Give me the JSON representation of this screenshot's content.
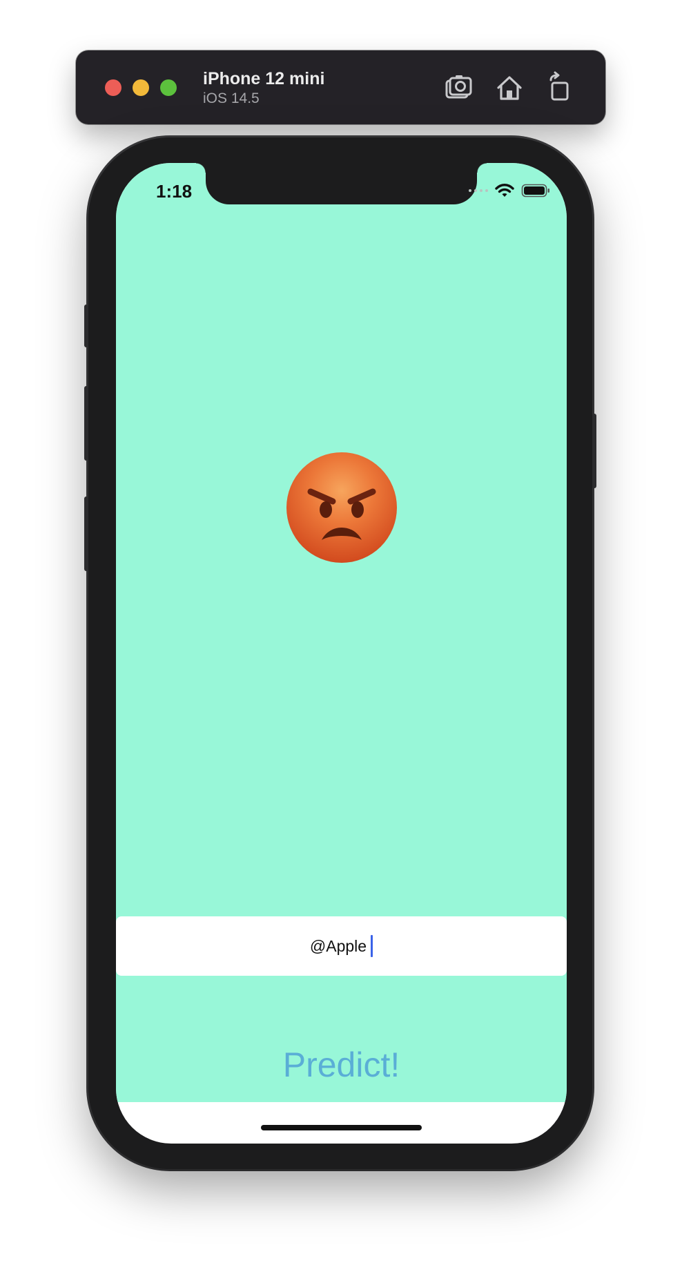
{
  "simulator": {
    "device_name": "iPhone 12 mini",
    "os_version": "iOS 14.5",
    "window_controls": [
      "close",
      "minimize",
      "zoom"
    ],
    "toolbar_icons": [
      "screenshot-icon",
      "home-icon",
      "rotate-icon"
    ]
  },
  "status_bar": {
    "time": "1:18",
    "icons": [
      "cellular-signal-icon",
      "wifi-icon",
      "battery-icon"
    ]
  },
  "app": {
    "background_color": "#98f7d8",
    "sentiment_emoji_icon": "angry-face-icon",
    "search_field": {
      "value": "@Apple"
    },
    "predict_button": {
      "label": "Predict!",
      "color": "#5aaed6"
    }
  }
}
